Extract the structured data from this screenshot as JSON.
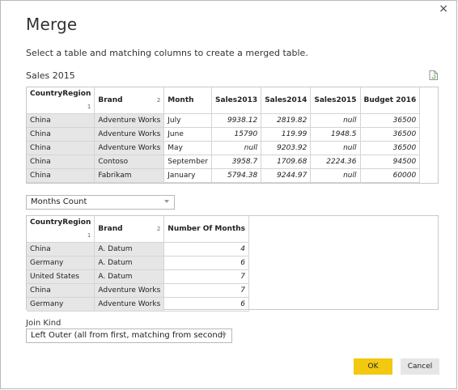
{
  "dialog": {
    "title": "Merge",
    "subtitle": "Select a table and matching columns to create a merged table.",
    "close_glyph": "×"
  },
  "table1": {
    "name": "Sales 2015",
    "headers": [
      {
        "label": "CountryRegion",
        "sort": "1"
      },
      {
        "label": "Brand",
        "sort": "2"
      },
      {
        "label": "Month",
        "sort": ""
      },
      {
        "label": "Sales2013",
        "sort": ""
      },
      {
        "label": "Sales2014",
        "sort": ""
      },
      {
        "label": "Sales2015",
        "sort": ""
      },
      {
        "label": "Budget 2016",
        "sort": ""
      }
    ],
    "rows": [
      [
        "China",
        "Adventure Works",
        "July",
        "9938.12",
        "2819.82",
        "null",
        "36500"
      ],
      [
        "China",
        "Adventure Works",
        "June",
        "15790",
        "119.99",
        "1948.5",
        "36500"
      ],
      [
        "China",
        "Adventure Works",
        "May",
        "null",
        "9203.92",
        "null",
        "36500"
      ],
      [
        "China",
        "Contoso",
        "September",
        "3958.7",
        "1709.68",
        "2224.36",
        "94500"
      ],
      [
        "China",
        "Fabrikam",
        "January",
        "5794.38",
        "9244.97",
        "null",
        "60000"
      ]
    ]
  },
  "table2_select": {
    "value": "Months Count"
  },
  "table2": {
    "headers": [
      {
        "label": "CountryRegion",
        "sort": "1"
      },
      {
        "label": "Brand",
        "sort": "2"
      },
      {
        "label": "Number Of Months",
        "sort": ""
      }
    ],
    "rows": [
      [
        "China",
        "A. Datum",
        "4"
      ],
      [
        "Germany",
        "A. Datum",
        "6"
      ],
      [
        "United States",
        "A. Datum",
        "7"
      ],
      [
        "China",
        "Adventure Works",
        "7"
      ],
      [
        "Germany",
        "Adventure Works",
        "6"
      ]
    ]
  },
  "join": {
    "label": "Join Kind",
    "value": "Left Outer (all from first, matching from second)"
  },
  "buttons": {
    "ok": "OK",
    "cancel": "Cancel"
  },
  "colors": {
    "ok_button": "#f2c811",
    "key_column": "#e6e6e6"
  }
}
